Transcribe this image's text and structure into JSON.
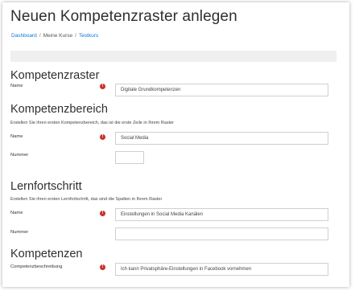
{
  "page": {
    "title": "Neuen Kompetenzraster anlegen"
  },
  "breadcrumb": {
    "items": [
      "Dashboard",
      "Meine Kurse",
      "Testkurs"
    ],
    "sep": "/"
  },
  "kompetenzraster": {
    "heading": "Kompetenzraster",
    "name_label": "Name",
    "name_value": "Digitale Grundkompetenzen"
  },
  "kompetenzbereich": {
    "heading": "Kompetenzbereich",
    "help": "Erstellen Sie ihren ersten Kompetenzbereich, das ist die erste Zeile in Ihrem Raster",
    "name_label": "Name",
    "name_value": "Social Media",
    "nummer_label": "Nummer",
    "nummer_value": ""
  },
  "lernfortschritt": {
    "heading": "Lernfortschritt",
    "help": "Erstellen Sie ihren ersten Lernfortschritt, das sind die Spalten in Ihrem Raster",
    "name_label": "Name",
    "name_value": "Einstellungen in Social Media Kanälen",
    "nummer_label": "Nummer",
    "nummer_value": ""
  },
  "kompetenzen": {
    "heading": "Kompetenzen",
    "desc_label": "Competenzbeschreibung",
    "desc_value": "Ich kann Privatsphäre-Einstellungen in Facebook vornehmen"
  },
  "required_icon": "!",
  "colors": {
    "link": "#1177d1",
    "required": "#c9302c"
  }
}
